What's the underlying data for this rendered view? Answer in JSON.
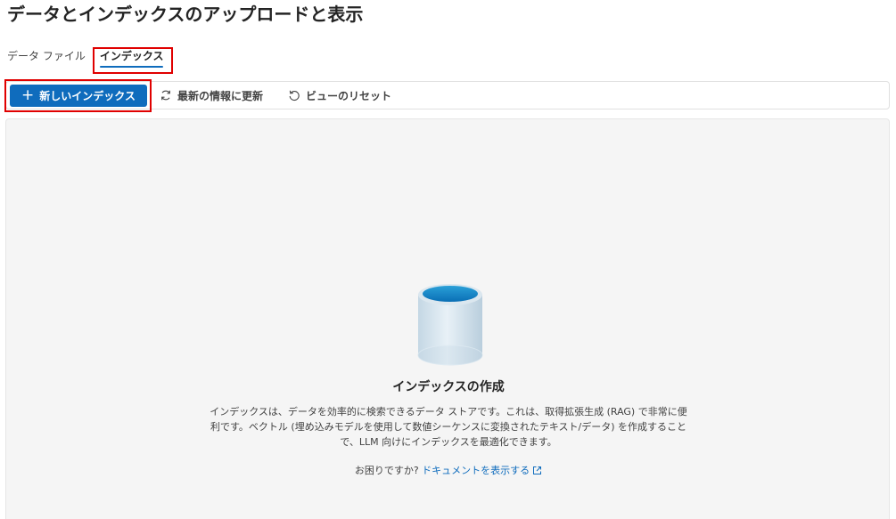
{
  "page": {
    "title": "データとインデックスのアップロードと表示"
  },
  "tabs": [
    {
      "label": "データ ファイル",
      "selected": false
    },
    {
      "label": "インデックス",
      "selected": true
    }
  ],
  "toolbar": {
    "new_index_label": "新しいインデックス",
    "refresh_label": "最新の情報に更新",
    "reset_view_label": "ビューのリセット"
  },
  "empty_state": {
    "title": "インデックスの作成",
    "description": "インデックスは、データを効率的に検索できるデータ ストアです。これは、取得拡張生成 (RAG) で非常に便利です。ベクトル (埋め込みモデルを使用して数値シーケンスに変換されたテキスト/データ) を作成することで、LLM 向けにインデックスを最適化できます。",
    "help_prefix": "お困りですか?",
    "doc_link_label": "ドキュメントを表示する"
  },
  "icons": {
    "new": "plus-icon",
    "refresh": "refresh-icon",
    "reset": "reset-icon",
    "illustration": "database-icon",
    "external": "external-link-icon"
  },
  "colors": {
    "accent": "#0f6cbd",
    "highlight_border": "#e00000",
    "panel_background": "#f5f5f5"
  }
}
